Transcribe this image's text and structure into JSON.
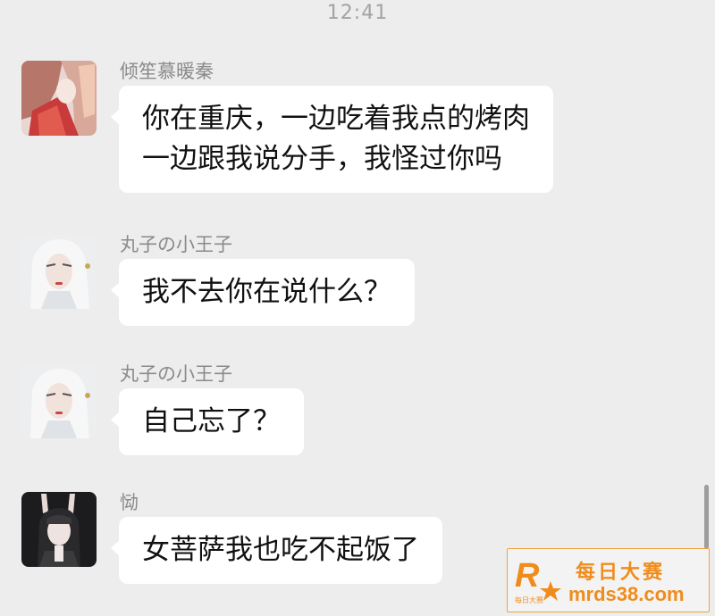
{
  "status": {
    "time": "12:41"
  },
  "messages": [
    {
      "sender": "倾笙慕暖秦",
      "lines": [
        "你在重庆，一边吃着我点的烤肉",
        "一边跟我说分手，我怪过你吗"
      ]
    },
    {
      "sender": "丸子の小王子",
      "lines": [
        "我不去你在说什么？"
      ]
    },
    {
      "sender": "丸子の小王子",
      "lines": [
        "自己忘了？"
      ]
    },
    {
      "sender": "恸",
      "lines": [
        "女菩萨我也吃不起饭了"
      ]
    }
  ],
  "watermark": {
    "title": "每日大赛",
    "url": "mrds38.com",
    "logo_letter": "R",
    "logo_caption": "每日大赛",
    "color": "#f08c1c"
  },
  "colors": {
    "background": "#ededed",
    "bubble": "#ffffff",
    "sender_name": "#8a8a8a",
    "time": "#a3a3a3"
  }
}
